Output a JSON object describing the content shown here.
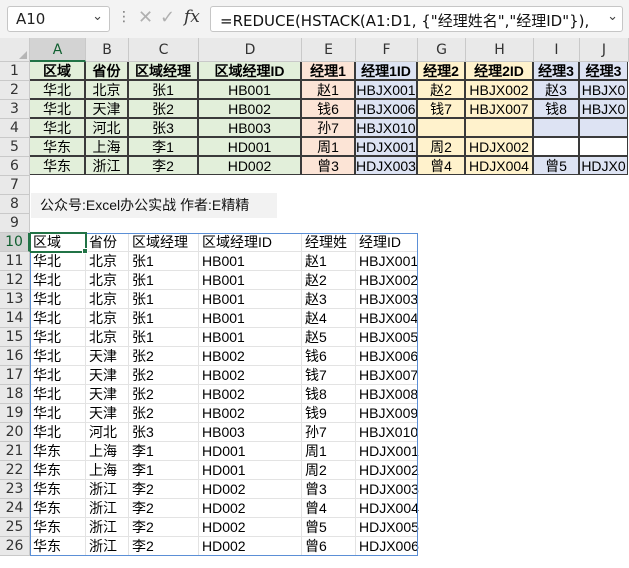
{
  "formula_bar": {
    "name_box": "A10",
    "formula": "=REDUCE(HSTACK(A1:D1, {\"经理姓名\",\"经理ID\"}),",
    "more_label": "⋮",
    "cancel_glyph": "✕",
    "enter_glyph": "✓",
    "fx_label": "fx"
  },
  "columns": [
    "A",
    "B",
    "C",
    "D",
    "E",
    "F",
    "G",
    "H",
    "I",
    "J"
  ],
  "rows": [
    "1",
    "2",
    "3",
    "4",
    "5",
    "6",
    "7",
    "8",
    "9",
    "10",
    "11",
    "12",
    "13",
    "14",
    "15",
    "16",
    "17",
    "18",
    "19",
    "20",
    "21",
    "22",
    "23",
    "24",
    "25",
    "26"
  ],
  "active": {
    "cell": "A10",
    "column": "A",
    "row": "10"
  },
  "colors": {
    "fill_green": "#e2efda",
    "fill_rose": "#fce4d6",
    "fill_yellow": "#fff2cc",
    "fill_blue": "#dde3f3",
    "accent": "#217346",
    "spill": "#5b8fd6"
  },
  "source_table": {
    "headers": [
      "区域",
      "省份",
      "区域经理",
      "区域经理ID",
      "经理1",
      "经理1ID",
      "经理2",
      "经理2ID",
      "经理3",
      "经理3"
    ],
    "rows": [
      [
        "华北",
        "北京",
        "张1",
        "HB001",
        "赵1",
        "HBJX001",
        "赵2",
        "HBJX002",
        "赵3",
        "HBJX0"
      ],
      [
        "华北",
        "天津",
        "张2",
        "HB002",
        "钱6",
        "HBJX006",
        "钱7",
        "HBJX007",
        "钱8",
        "HBJX0"
      ],
      [
        "华北",
        "河北",
        "张3",
        "HB003",
        "孙7",
        "HBJX010",
        "",
        "",
        "",
        ""
      ],
      [
        "华东",
        "上海",
        "李1",
        "HD001",
        "周1",
        "HDJX001",
        "周2",
        "HDJX002",
        "",
        ""
      ],
      [
        "华东",
        "浙江",
        "李2",
        "HD002",
        "曾3",
        "HDJX003",
        "曾4",
        "HDJX004",
        "曾5",
        "HDJX0"
      ]
    ]
  },
  "banner": "公众号:Excel办公实战  作者:E精精",
  "result_table": {
    "headers": [
      "区域",
      "省份",
      "区域经理",
      "区域经理ID",
      "经理姓",
      "经理ID"
    ],
    "rows": [
      [
        "华北",
        "北京",
        "张1",
        "HB001",
        "赵1",
        "HBJX001"
      ],
      [
        "华北",
        "北京",
        "张1",
        "HB001",
        "赵2",
        "HBJX002"
      ],
      [
        "华北",
        "北京",
        "张1",
        "HB001",
        "赵3",
        "HBJX003"
      ],
      [
        "华北",
        "北京",
        "张1",
        "HB001",
        "赵4",
        "HBJX004"
      ],
      [
        "华北",
        "北京",
        "张1",
        "HB001",
        "赵5",
        "HBJX005"
      ],
      [
        "华北",
        "天津",
        "张2",
        "HB002",
        "钱6",
        "HBJX006"
      ],
      [
        "华北",
        "天津",
        "张2",
        "HB002",
        "钱7",
        "HBJX007"
      ],
      [
        "华北",
        "天津",
        "张2",
        "HB002",
        "钱8",
        "HBJX008"
      ],
      [
        "华北",
        "天津",
        "张2",
        "HB002",
        "钱9",
        "HBJX009"
      ],
      [
        "华北",
        "河北",
        "张3",
        "HB003",
        "孙7",
        "HBJX010"
      ],
      [
        "华东",
        "上海",
        "李1",
        "HD001",
        "周1",
        "HDJX001"
      ],
      [
        "华东",
        "上海",
        "李1",
        "HD001",
        "周2",
        "HDJX002"
      ],
      [
        "华东",
        "浙江",
        "李2",
        "HD002",
        "曾3",
        "HDJX003"
      ],
      [
        "华东",
        "浙江",
        "李2",
        "HD002",
        "曾4",
        "HDJX004"
      ],
      [
        "华东",
        "浙江",
        "李2",
        "HD002",
        "曾5",
        "HDJX005"
      ],
      [
        "华东",
        "浙江",
        "李2",
        "HD002",
        "曾6",
        "HDJX006"
      ]
    ]
  }
}
